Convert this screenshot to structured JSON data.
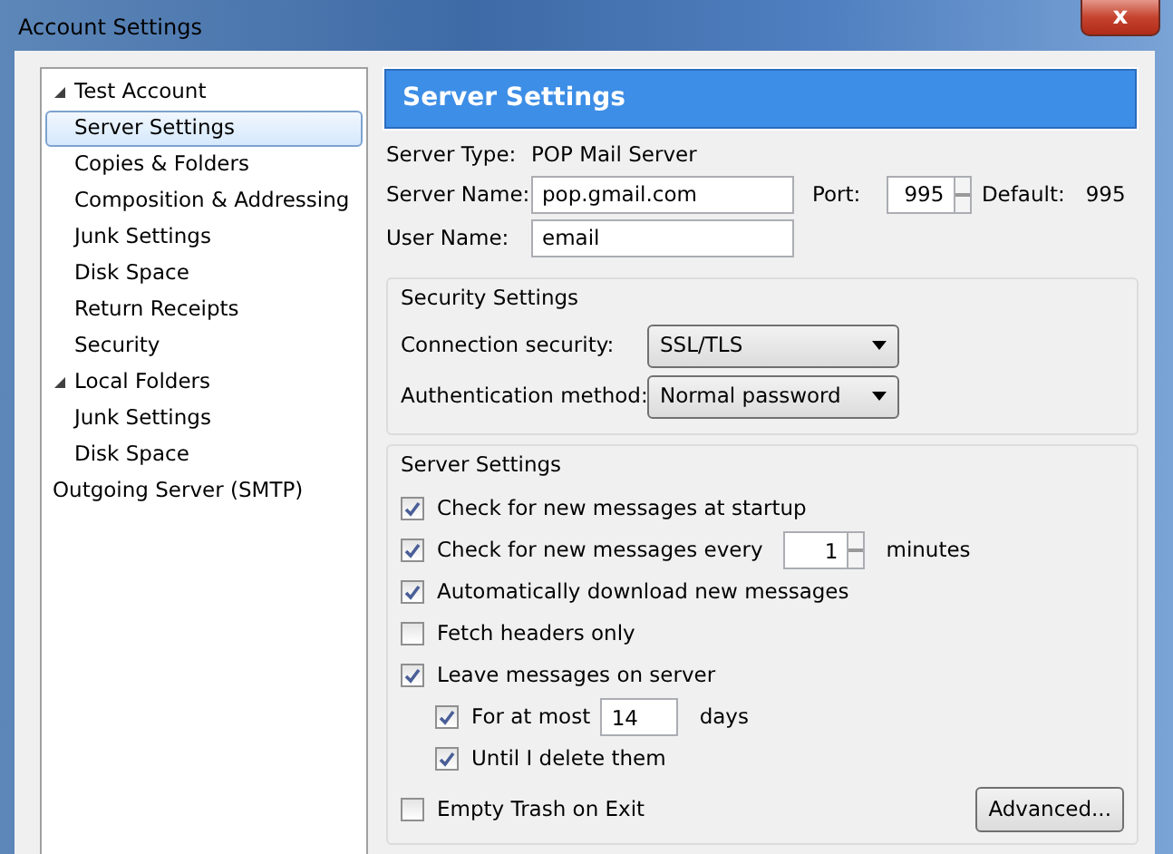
{
  "window": {
    "title": "Account Settings",
    "close": "x"
  },
  "tree": [
    {
      "label": "Test Account",
      "expanded": true,
      "selected": false,
      "children": [
        {
          "label": "Server Settings",
          "selected": true
        },
        {
          "label": "Copies & Folders",
          "selected": false
        },
        {
          "label": "Composition & Addressing",
          "selected": false
        },
        {
          "label": "Junk Settings",
          "selected": false
        },
        {
          "label": "Disk Space",
          "selected": false
        },
        {
          "label": "Return Receipts",
          "selected": false
        },
        {
          "label": "Security",
          "selected": false
        }
      ]
    },
    {
      "label": "Local Folders",
      "expanded": true,
      "selected": false,
      "children": [
        {
          "label": "Junk Settings",
          "selected": false
        },
        {
          "label": "Disk Space",
          "selected": false
        }
      ]
    },
    {
      "label": "Outgoing Server (SMTP)",
      "selected": false
    }
  ],
  "panel": {
    "title": "Server Settings",
    "server_type": {
      "label": "Server Type:",
      "value": "POP Mail Server"
    },
    "server_name": {
      "label": "Server Name:",
      "value": "pop.gmail.com"
    },
    "port": {
      "label": "Port:",
      "value": "995"
    },
    "default": {
      "label": "Default:",
      "value": "995"
    },
    "user_name": {
      "label": "User Name:",
      "value": "email"
    },
    "security": {
      "title": "Security Settings",
      "rows": [
        {
          "label": "Connection security:",
          "value": "SSL/TLS"
        },
        {
          "label": "Authentication method:",
          "value": "Normal password"
        }
      ]
    },
    "server": {
      "title": "Server Settings",
      "options": [
        {
          "kind": "checkbox",
          "label": "Check for new messages at startup",
          "checked": true
        },
        {
          "kind": "spinner",
          "label": "Check for new messages every",
          "checked": true,
          "value": "1",
          "suffix": "minutes"
        },
        {
          "kind": "checkbox",
          "label": "Automatically download new messages",
          "checked": true
        },
        {
          "kind": "checkbox",
          "label": "Fetch headers only",
          "checked": false
        },
        {
          "kind": "checkbox",
          "label": "Leave messages on server",
          "checked": true,
          "children": [
            {
              "kind": "field",
              "label": "For at most",
              "checked": true,
              "value": "14",
              "suffix": "days"
            },
            {
              "kind": "checkbox",
              "label": "Until I delete them",
              "checked": true
            }
          ]
        },
        {
          "kind": "checkbox",
          "label": "Empty Trash on Exit",
          "checked": false
        }
      ],
      "advanced": "Advanced..."
    }
  }
}
